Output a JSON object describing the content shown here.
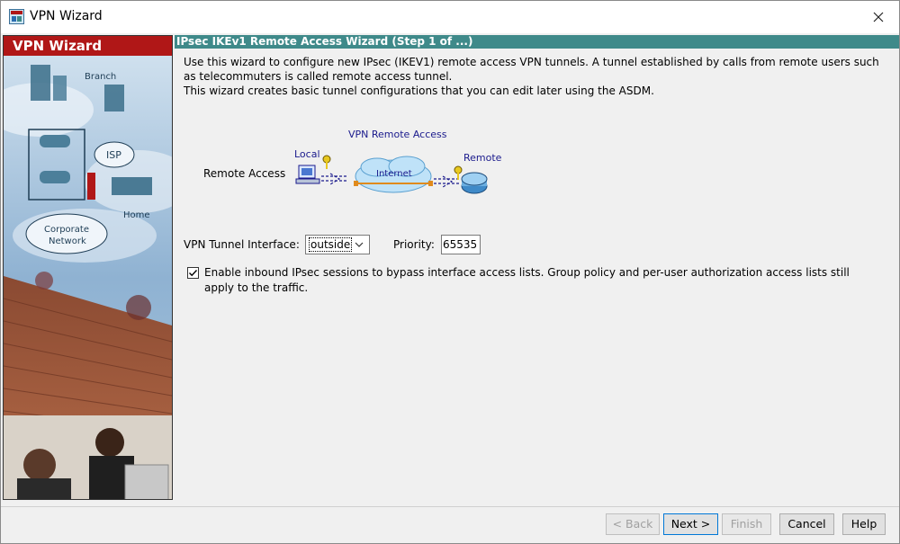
{
  "window": {
    "title": "VPN Wizard",
    "icon": "vpn-wizard-app-icon",
    "close_icon": "close-icon"
  },
  "left_panel": {
    "header": "VPN Wizard",
    "art_labels": {
      "branch": "Branch",
      "isp": "ISP",
      "home": "Home",
      "corporate": "Corporate",
      "network": "Network"
    }
  },
  "step": {
    "header": "IPsec IKEv1 Remote Access Wizard  (Step 1 of ...)"
  },
  "description": {
    "line1": "Use this wizard to configure new IPsec (IKEV1) remote access VPN tunnels. A tunnel established by calls from remote users such as telecommuters is called remote access tunnel.",
    "line2": "This wizard creates basic tunnel configurations that you can edit later using the ASDM."
  },
  "diagram": {
    "row_label": "Remote Access",
    "title": "VPN Remote Access",
    "local": "Local",
    "internet": "Internet",
    "remote": "Remote"
  },
  "interface": {
    "label": "VPN Tunnel Interface:",
    "selected": "outside",
    "priority_label": "Priority:",
    "priority_value": "65535"
  },
  "bypass": {
    "checked": true,
    "text": "Enable inbound IPsec sessions to bypass interface access lists. Group policy and per-user authorization access lists still apply to the traffic."
  },
  "buttons": {
    "back": "< Back",
    "next": "Next >",
    "finish": "Finish",
    "cancel": "Cancel",
    "help": "Help"
  },
  "colors": {
    "left_header": "#b01717",
    "step_header": "#3f8a8a",
    "diagram_title": "#1a1a8c"
  }
}
